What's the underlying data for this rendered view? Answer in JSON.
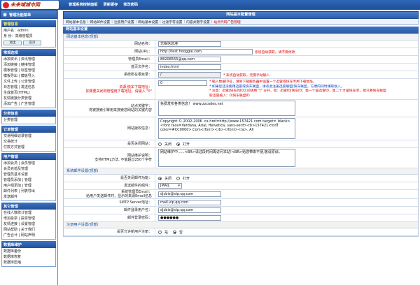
{
  "logo": {
    "text": "未来域城市网"
  },
  "topnav": [
    "管理系统控制面板",
    "更新缓存",
    "修改密码"
  ],
  "sidebar": {
    "header": "管理功能菜单",
    "sections": [
      {
        "title": "管理信息",
        "title_red": true,
        "rows": [
          "用户名：admin",
          "身  份：高级管理员"
        ],
        "buttons": [
          "退出",
          "首页"
        ]
      },
      {
        "title": "常规选项",
        "rows": [
          "添加资讯 | 资讯管理",
          "添加链接 | 链接管理",
          "模板管理 | 标签管理",
          "模板导出 | 模板导入",
          "文件上传 | 公告管理",
          "日志管理 | 发送信息",
          "生成首页(HTML)",
          "友情链接分类管理",
          "添加广告 | 广告管理"
        ]
      },
      {
        "title": "分类信息",
        "rows": [
          "分类管理"
        ]
      },
      {
        "title": "订单管理",
        "rows": [
          "交易明细记录管理",
          "交易统计",
          "付款方式管理"
        ]
      },
      {
        "title": "用户管理",
        "rows": [
          "添加会员 | 会员管理",
          "会员充值及管理",
          "管理员基本设置",
          "管理员添加 | 管理",
          "用户组添加 | 管理",
          "邮件列表 | 列表导出",
          "发送邮件"
        ]
      },
      {
        "title": "其它管理",
        "rows": [
          "在线人数统计管理",
          "增加投票 | 投票管理",
          "友情连接 | 设置管理",
          "网站帮助 | 关于我们",
          "广告合计 | 网站声明"
        ]
      },
      {
        "title": "数据库维护",
        "rows": [
          "数据库备份",
          "数据库恢复",
          "数据库压缩"
        ]
      }
    ]
  },
  "page": {
    "title": "网站基本配置管理"
  },
  "tabs": [
    "网站基本信息",
    "网站邮件设置",
    "注册用户设置",
    "网站基本设置",
    "过滤字符设置",
    "内容关键字设置",
    "站点代码广告管理"
  ],
  "section1": "网站基本设置",
  "sub1": "网站基本信息(顶部)",
  "form": {
    "site_name": {
      "label": "网站名称：",
      "value": "无锡信息港"
    },
    "site_url": {
      "label": "网站URL：",
      "value": "http://test.hooggie.com",
      "hint": "系统自动获取，请不要修改"
    },
    "admin_email": {
      "label": "管理员Email：",
      "value": "88208555@qq.com"
    },
    "home_file": {
      "label": "首页文件名：",
      "value": "index.html"
    },
    "root_path": {
      "label": "系统所在根目录：",
      "value": "/",
      "hint": "* 系统自动获取，无需手动输入"
    },
    "rss": {
      "label": "资源|快车下载地址：",
      "label2": "如果要关闭则管理用下载地址，请输入 \"0\"",
      "value": "0",
      "hints": [
        "* 输入数据ID号，请到下载服务器中设置一个迅雷或快车专用下载地址。",
        "* 如果您还没使用迅雷或快车联盟，请点此注册迅雷联盟|快车联盟，方便的同时赚取收入。",
        "* 注意：迅雷|快车的ID之间请用 \"|\" 分开，如：迅雷ID|快车ID；第一个是迅雷ID，第二个才是快车ID，如只要快车联盟",
        "取迅雷输入：0|快车联盟ID"
      ]
    },
    "keywords": {
      "label": "站点关键字：",
      "label2": "将被搜索引擎用来搜索您网站的关键内容",
      "value": "免费发布各类信息！ www.zzcodes.net"
    },
    "copyright": {
      "label": "网站版权信息：",
      "value": "Copyright © 2002-2006 <a href=http://www.157421.com target=_blank><font face=Verdana, Arial, Helvetica, sans-serif><b>157421<font color=#CC0000>.Com</font></b></font></a>. All"
    },
    "close_site": {
      "label": "是否关闭网站：",
      "opt_off": "关闭",
      "opt_on": "打开"
    },
    "maint": {
      "label": "网站维护说明：",
      "label2": "支持HTML方法, 不能超过250个字符",
      "value": "网站维护中......<BR>请过段时间再访问本站!<BR>给您带来不便,敬请原谅。"
    }
  },
  "sub2": "系统邮件设置(顶部)",
  "mail": {
    "enable": {
      "label": "是否关闭邮件功能：",
      "opt_on": "关闭",
      "opt_off": "打开"
    },
    "component": {
      "label": "发送邮件的组件：",
      "value": "JMAIL"
    },
    "sender": {
      "label": "系统管理员Email：",
      "label2": "给用户发送邮件时，显示的来源Email信息",
      "value": "djcbiz@vip.qq.com"
    },
    "smtp": {
      "label": "SMTP Server地址：",
      "value": "mail.vip.qq.com"
    },
    "login": {
      "label": "邮件登录用户名：",
      "value": "djcbiz@vip.qq.com"
    },
    "password": {
      "label": "邮件登录密码：",
      "value": "●●●●●●"
    }
  },
  "sub3": "注册用户设置(顶部)",
  "reg": {
    "label": "是否允许新用户注册：",
    "opt_yes": "是",
    "opt_no": "否"
  },
  "colors": {
    "header": "#2b5fae",
    "accent_red": "#dd0000",
    "link_blue": "#0040c0"
  }
}
